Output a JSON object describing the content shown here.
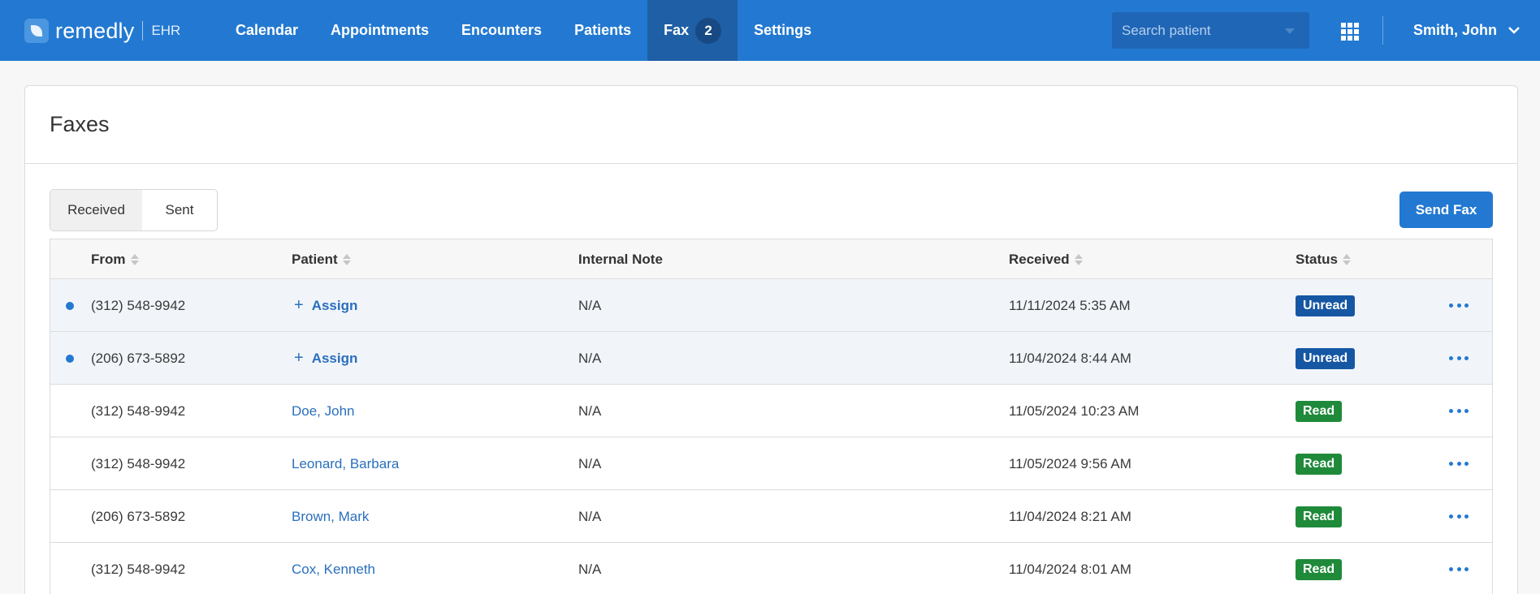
{
  "brand": {
    "name": "remedly",
    "sub": "EHR",
    "logo_icon": "leaf-logo-icon"
  },
  "nav": {
    "items": [
      {
        "label": "Calendar",
        "active": false
      },
      {
        "label": "Appointments",
        "active": false
      },
      {
        "label": "Encounters",
        "active": false
      },
      {
        "label": "Patients",
        "active": false
      },
      {
        "label": "Fax",
        "active": true,
        "badge": "2"
      },
      {
        "label": "Settings",
        "active": false
      }
    ]
  },
  "search": {
    "placeholder": "Search patient"
  },
  "user": {
    "name": "Smith, John"
  },
  "page": {
    "title": "Faxes"
  },
  "tabs": {
    "received": "Received",
    "sent": "Sent",
    "selected": "Received"
  },
  "actions": {
    "send_fax": "Send Fax"
  },
  "table": {
    "columns": {
      "from": "From",
      "patient": "Patient",
      "note": "Internal Note",
      "received": "Received",
      "status": "Status"
    },
    "rows": [
      {
        "unread": true,
        "from": "(312) 548-9942",
        "patient": "",
        "assign": "Assign",
        "note": "N/A",
        "received": "11/11/2024 5:35 AM",
        "status": "Unread"
      },
      {
        "unread": true,
        "from": "(206) 673-5892",
        "patient": "",
        "assign": "Assign",
        "note": "N/A",
        "received": "11/04/2024 8:44 AM",
        "status": "Unread"
      },
      {
        "unread": false,
        "from": "(312) 548-9942",
        "patient": "Doe, John",
        "note": "N/A",
        "received": "11/05/2024 10:23 AM",
        "status": "Read"
      },
      {
        "unread": false,
        "from": "(312) 548-9942",
        "patient": "Leonard, Barbara",
        "note": "N/A",
        "received": "11/05/2024 9:56 AM",
        "status": "Read"
      },
      {
        "unread": false,
        "from": "(206) 673-5892",
        "patient": "Brown, Mark",
        "note": "N/A",
        "received": "11/04/2024 8:21 AM",
        "status": "Read"
      },
      {
        "unread": false,
        "from": "(312) 548-9942",
        "patient": "Cox, Kenneth",
        "note": "N/A",
        "received": "11/04/2024 8:01 AM",
        "status": "Read"
      }
    ]
  },
  "colors": {
    "primary": "#2379d1",
    "nav_active": "#1f5fa5",
    "unread_badge": "#1657a3",
    "read_badge": "#1f8a3a",
    "link": "#2a6fbd"
  }
}
